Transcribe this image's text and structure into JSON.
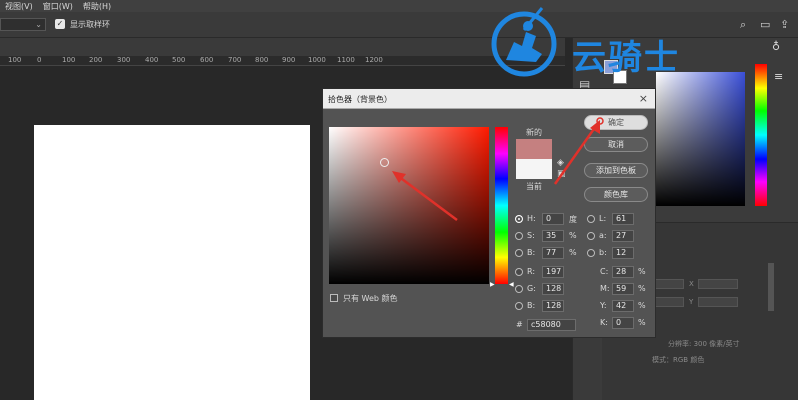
{
  "menubar": {
    "items": [
      "视图(V)",
      "窗口(W)",
      "帮助(H)"
    ]
  },
  "options": {
    "sample_ring_label": "显示取样环",
    "check_mark": "✓"
  },
  "ruler": {
    "numbers": [
      "100",
      "0",
      "100",
      "200",
      "300",
      "400",
      "500",
      "600",
      "700",
      "800",
      "900",
      "1000",
      "1100",
      "1200"
    ]
  },
  "watermark": {
    "text": "云骑士"
  },
  "dialog": {
    "title": "拾色器（背景色）",
    "close": "×",
    "new_label": "新的",
    "current_label": "当前",
    "web_only_label": "只有 Web 颜色",
    "buttons": {
      "ok": "确定",
      "cancel": "取消",
      "add_swatch": "添加到色板",
      "color_libraries": "颜色库"
    },
    "hsb": {
      "h_label": "H:",
      "h": "0",
      "h_unit": "度",
      "s_label": "S:",
      "s": "35",
      "s_unit": "%",
      "b_label": "B:",
      "b": "77",
      "b_unit": "%"
    },
    "lab": {
      "l_label": "L:",
      "l": "61",
      "a_label": "a:",
      "a": "27",
      "b_label": "b:",
      "b": "12"
    },
    "rgb": {
      "r_label": "R:",
      "r": "197",
      "g_label": "G:",
      "g": "128",
      "b_label": "B:",
      "b": "128"
    },
    "cmyk": {
      "c_label": "C:",
      "c": "28",
      "m_label": "M:",
      "m": "59",
      "y_label": "Y:",
      "y": "42",
      "k_label": "K:",
      "k": "0",
      "unit": "%"
    },
    "hex_label": "#",
    "hex": "c58080"
  },
  "right_panel": {
    "resolution_text": "分辨率: 300 像素/英寸",
    "mode_text": "模式：RGB 颜色",
    "x_label": "X",
    "y_label": "Y"
  },
  "colors": {
    "new_color": "#c58080",
    "current_color": "#f5f5f5",
    "arrow_red": "#e0312a",
    "watermark_blue": "#1f86e0"
  }
}
